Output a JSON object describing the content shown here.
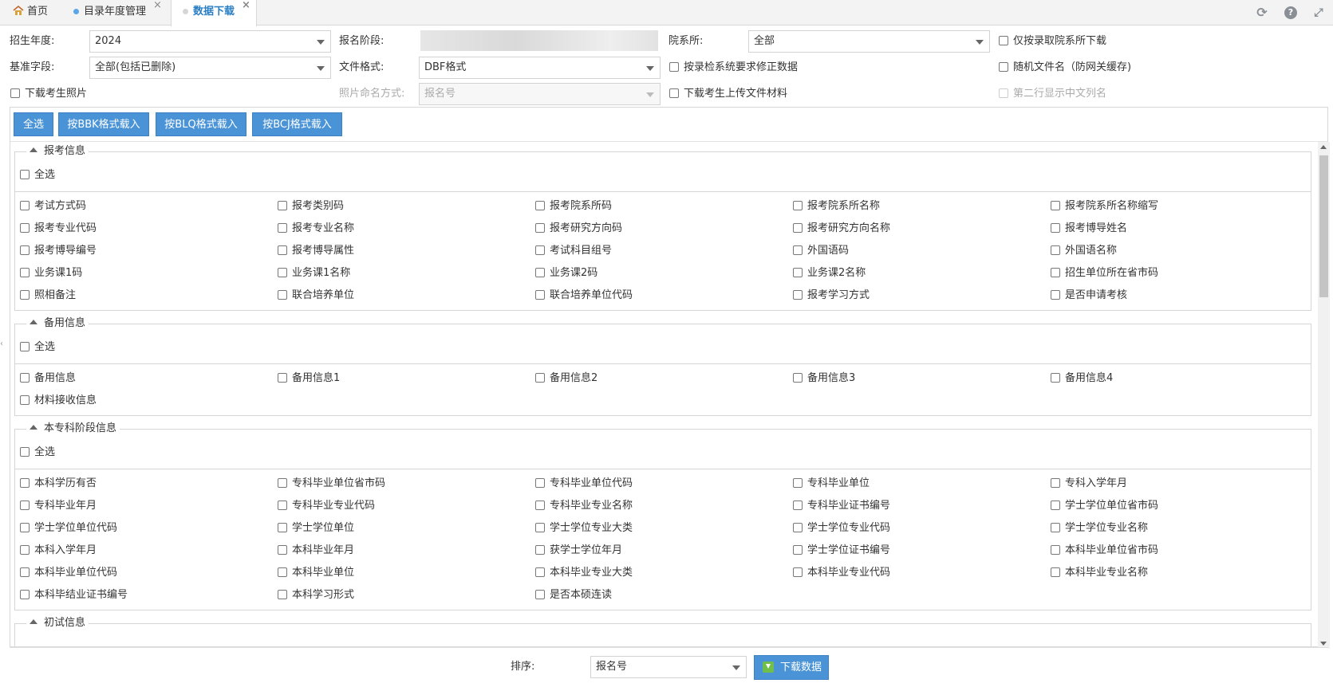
{
  "tabs": [
    {
      "label": "首页"
    },
    {
      "label": "目录年度管理"
    },
    {
      "label": "数据下载"
    }
  ],
  "filters": {
    "year_label": "招生年度:",
    "year_value": "2024",
    "stage_label": "报名阶段:",
    "dept_label": "院系所:",
    "dept_value": "全部",
    "only_admitted": "仅按录取院系所下载",
    "base_field_label": "基准字段:",
    "base_field_value": "全部(包括已删除)",
    "format_label": "文件格式:",
    "format_value": "DBF格式",
    "fix_data": "按录检系统要求修正数据",
    "random_name": "随机文件名（防网关缓存)",
    "download_photo": "下载考生照片",
    "photo_naming_label": "照片命名方式:",
    "photo_naming_value": "报名号",
    "download_files": "下载考生上传文件材料",
    "second_row_cn": "第二行显示中文列名"
  },
  "buttons": {
    "select_all": "全选",
    "bbk": "按BBK格式载入",
    "blq": "按BLQ格式载入",
    "bcj": "按BCJ格式载入"
  },
  "sections": [
    {
      "title": "报考信息",
      "select_all": "全选",
      "items": [
        "考试方式码",
        "报考类别码",
        "报考院系所码",
        "报考院系所名称",
        "报考院系所名称缩写",
        "报考专业代码",
        "报考专业名称",
        "报考研究方向码",
        "报考研究方向名称",
        "报考博导姓名",
        "报考博导编号",
        "报考博导属性",
        "考试科目组号",
        "外国语码",
        "外国语名称",
        "业务课1码",
        "业务课1名称",
        "业务课2码",
        "业务课2名称",
        "招生单位所在省市码",
        "照相备注",
        "联合培养单位",
        "联合培养单位代码",
        "报考学习方式",
        "是否申请考核"
      ]
    },
    {
      "title": "备用信息",
      "select_all": "全选",
      "items": [
        "备用信息",
        "备用信息1",
        "备用信息2",
        "备用信息3",
        "备用信息4",
        "材料接收信息"
      ]
    },
    {
      "title": "本专科阶段信息",
      "select_all": "全选",
      "items": [
        "本科学历有否",
        "专科毕业单位省市码",
        "专科毕业单位代码",
        "专科毕业单位",
        "专科入学年月",
        "专科毕业年月",
        "专科毕业专业代码",
        "专科毕业专业名称",
        "专科毕业证书编号",
        "学士学位单位省市码",
        "学士学位单位代码",
        "学士学位单位",
        "学士学位专业大类",
        "学士学位专业代码",
        "学士学位专业名称",
        "本科入学年月",
        "本科毕业年月",
        "获学士学位年月",
        "学士学位证书编号",
        "本科毕业单位省市码",
        "本科毕业单位代码",
        "本科毕业单位",
        "本科毕业专业大类",
        "本科毕业专业代码",
        "本科毕业专业名称",
        "本科毕结业证书编号",
        "本科学习形式",
        "是否本硕连读"
      ]
    },
    {
      "title": "初试信息"
    }
  ],
  "footer": {
    "sort_label": "排序:",
    "sort_value": "报名号",
    "download": "下载数据"
  },
  "colors": {
    "accent": "#4a93d6",
    "active_tab": "#2a7fc4"
  }
}
